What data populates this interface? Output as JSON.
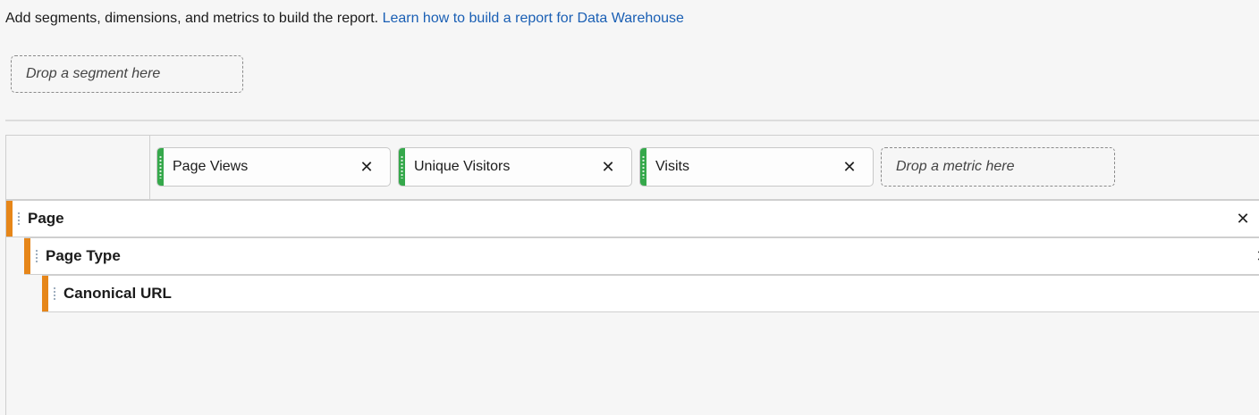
{
  "intro": {
    "text": "Add segments, dimensions, and metrics to build the report.",
    "link": "Learn how to build a report for Data Warehouse"
  },
  "segment_drop": {
    "placeholder": "Drop a segment here"
  },
  "metrics": [
    {
      "label": "Page Views",
      "close": "✕"
    },
    {
      "label": "Unique Visitors",
      "close": "✕"
    },
    {
      "label": "Visits",
      "close": "✕"
    }
  ],
  "metric_drop": {
    "placeholder": "Drop a metric here"
  },
  "dimensions": [
    {
      "label": "Page",
      "close": "✕"
    },
    {
      "label": "Page Type",
      "close": "✕"
    },
    {
      "label": "Canonical URL"
    }
  ],
  "colors": {
    "metric_accent": "#35a84b",
    "dimension_accent": "#e68619",
    "link": "#1a5fb4"
  }
}
